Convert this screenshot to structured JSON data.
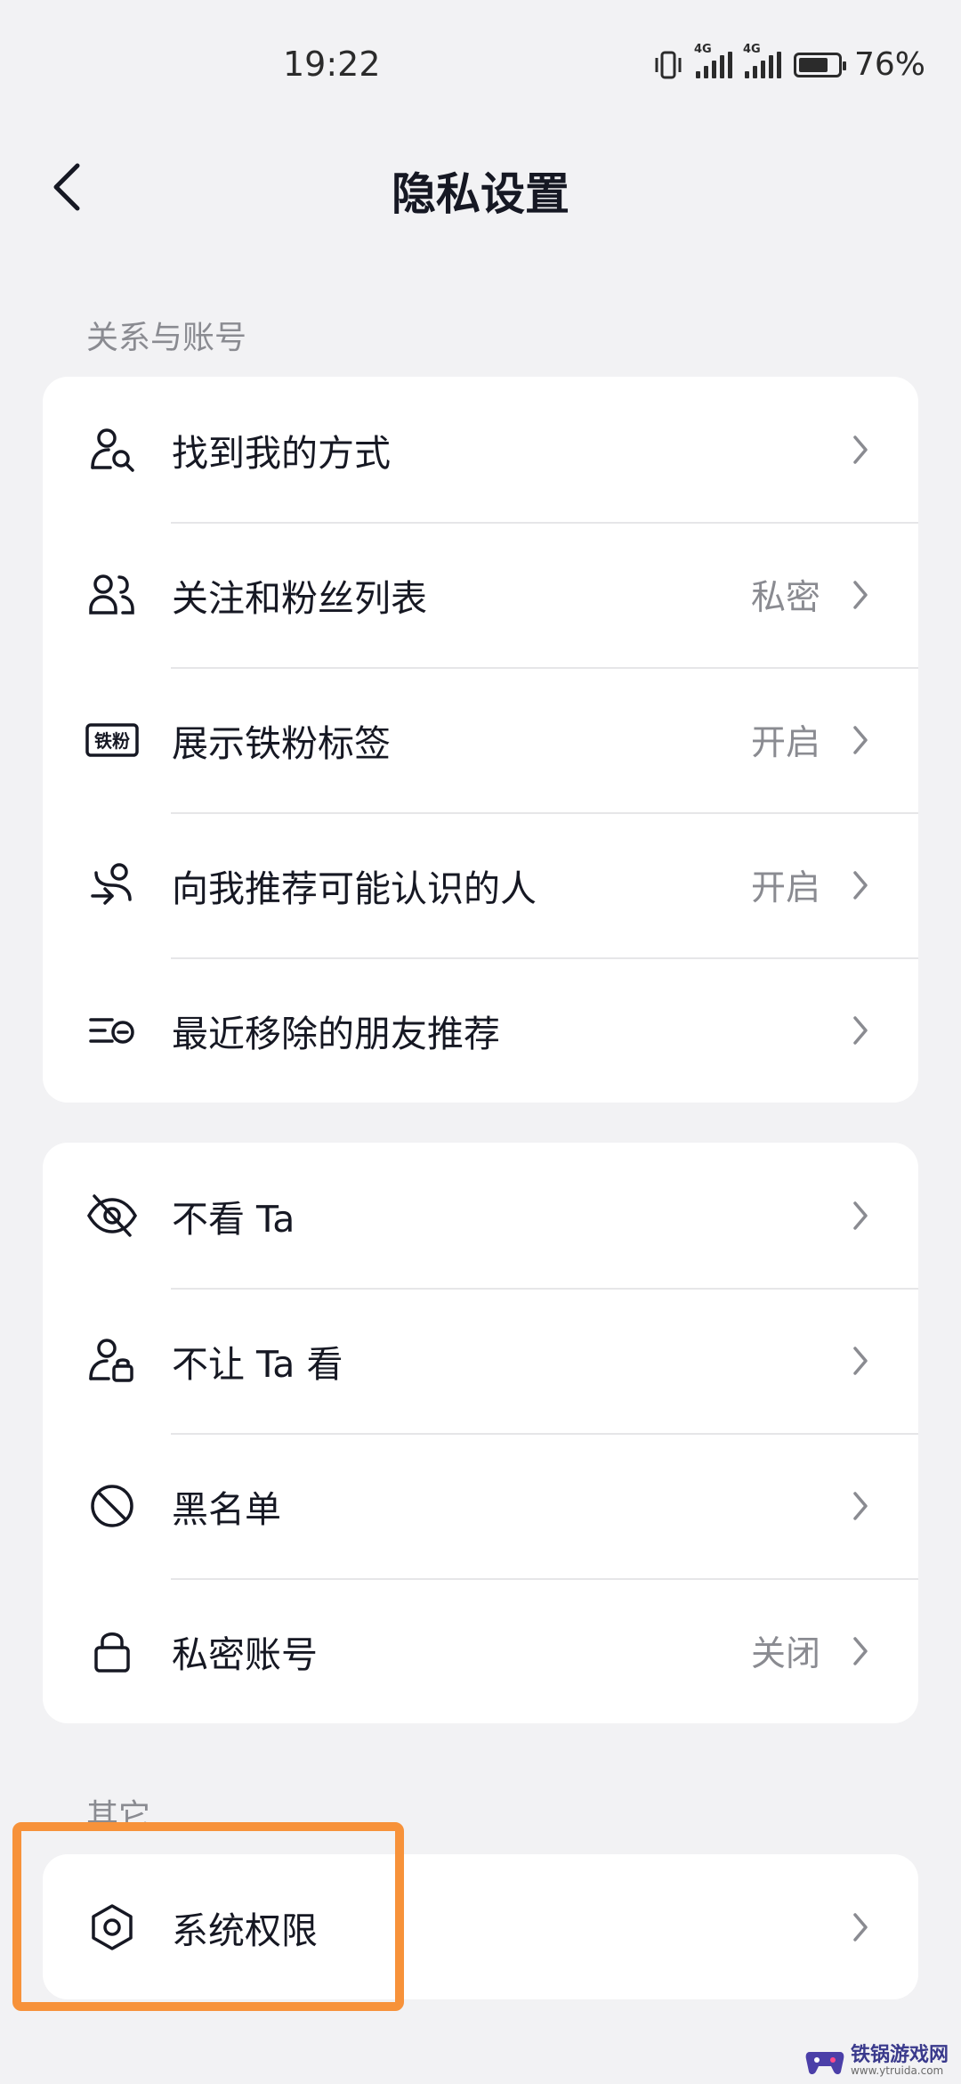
{
  "status_bar": {
    "time": "19:22",
    "network_1": "4G",
    "network_2": "4G",
    "battery_percent": "76%",
    "battery_level": 0.76,
    "icons": [
      "vibrate-icon",
      "signal-icon",
      "signal-icon",
      "battery-charging-icon"
    ]
  },
  "header": {
    "back_icon": "chevron-left-icon",
    "title": "隐私设置"
  },
  "sections": {
    "relationship_label": "关系与账号",
    "other_label": "其它"
  },
  "group1": [
    {
      "icon": "person-search-icon",
      "label": "找到我的方式",
      "value": ""
    },
    {
      "icon": "people-icon",
      "label": "关注和粉丝列表",
      "value": "私密"
    },
    {
      "icon": "fan-badge-icon",
      "icon_text": "铁粉",
      "label": "展示铁粉标签",
      "value": "开启"
    },
    {
      "icon": "person-recommend-icon",
      "label": "向我推荐可能认识的人",
      "value": "开启"
    },
    {
      "icon": "list-remove-icon",
      "label": "最近移除的朋友推荐",
      "value": ""
    }
  ],
  "group2": [
    {
      "icon": "eye-off-icon",
      "label": "不看 Ta",
      "value": ""
    },
    {
      "icon": "person-lock-icon",
      "label": "不让 Ta 看",
      "value": ""
    },
    {
      "icon": "block-icon",
      "label": "黑名单",
      "value": ""
    },
    {
      "icon": "lock-icon",
      "label": "私密账号",
      "value": "关闭"
    }
  ],
  "group3": [
    {
      "icon": "hexagon-settings-icon",
      "label": "系统权限",
      "value": ""
    }
  ],
  "watermark": {
    "main": "铁锅游戏网",
    "url": "www.ytruida.com"
  },
  "colors": {
    "background": "#f2f2f4",
    "card": "#ffffff",
    "text": "#161823",
    "secondary_text": "#8a8b91",
    "highlight": "#f7923a"
  }
}
